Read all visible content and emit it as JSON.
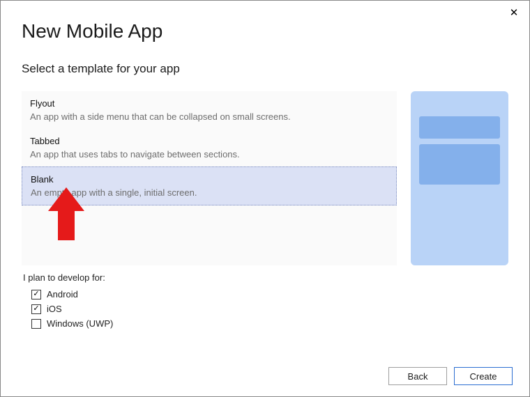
{
  "window": {
    "close_glyph": "✕"
  },
  "title": "New Mobile App",
  "subtitle": "Select a template for your app",
  "templates": [
    {
      "name": "Flyout",
      "desc": "An app with a side menu that can be collapsed on small screens.",
      "selected": false
    },
    {
      "name": "Tabbed",
      "desc": "An app that uses tabs to navigate between sections.",
      "selected": false
    },
    {
      "name": "Blank",
      "desc": "An empty app with a single, initial screen.",
      "selected": true
    }
  ],
  "dev_for": {
    "label": "I plan to develop for:",
    "options": [
      {
        "label": "Android",
        "checked": true
      },
      {
        "label": "iOS",
        "checked": true
      },
      {
        "label": "Windows (UWP)",
        "checked": false
      }
    ]
  },
  "buttons": {
    "back": "Back",
    "create": "Create"
  },
  "annotation": {
    "arrow_color": "#e51a1a"
  }
}
